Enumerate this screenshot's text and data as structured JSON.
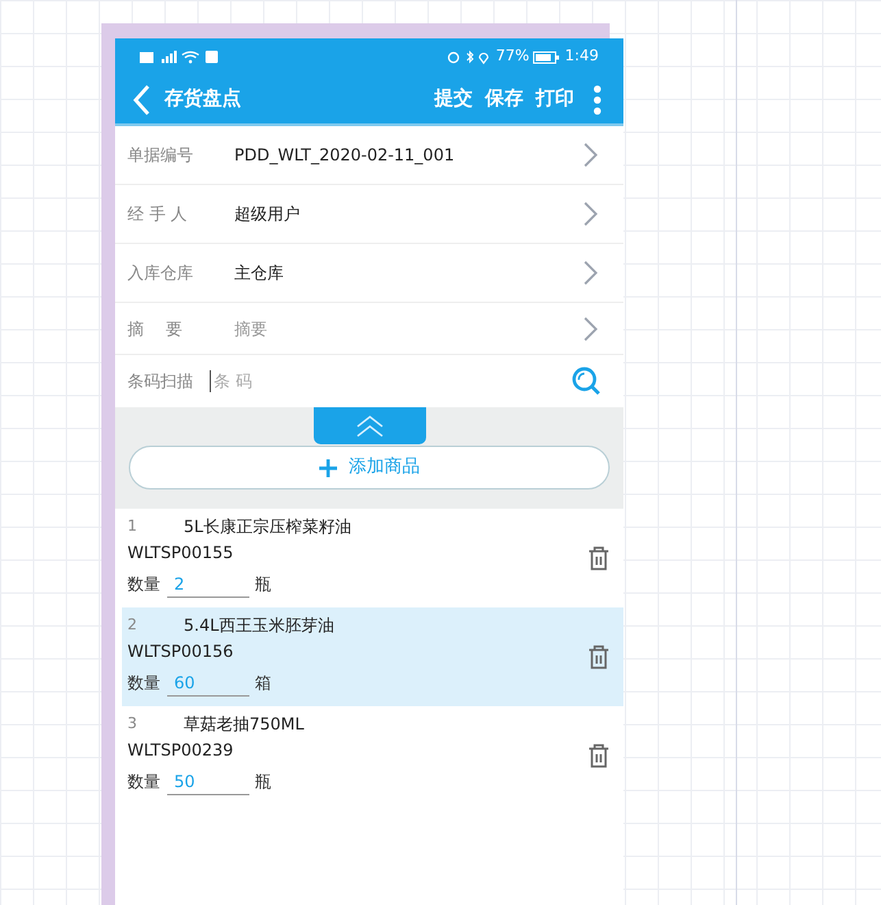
{
  "status_bar": {
    "battery_text": "77%",
    "time": "1:49"
  },
  "header": {
    "title": "存货盘点",
    "actions": [
      "提交",
      "保存",
      "打印"
    ]
  },
  "form": {
    "rows": [
      {
        "label": "单据编号",
        "value": "PDD_WLT_2020-02-11_001"
      },
      {
        "label": "经 手 人",
        "value": "超级用户"
      },
      {
        "label": "入库仓库",
        "value": "主仓库"
      },
      {
        "label": "摘　 要",
        "placeholder": "摘要"
      }
    ],
    "scan": {
      "label": "条码扫描",
      "placeholder": "条 码"
    }
  },
  "add_button": "添加商品",
  "items": [
    {
      "index": "1",
      "name": "5L长康正宗压榨菜籽油",
      "code": "WLTSP00155",
      "qty_label": "数量",
      "qty": "2",
      "unit": "瓶",
      "selected": false
    },
    {
      "index": "2",
      "name": "5.4L西王玉米胚芽油",
      "code": "WLTSP00156",
      "qty_label": "数量",
      "qty": "60",
      "unit": "箱",
      "selected": true
    },
    {
      "index": "3",
      "name": "草菇老抽750ML",
      "code": "WLTSP00239",
      "qty_label": "数量",
      "qty": "50",
      "unit": "瓶",
      "selected": false
    }
  ]
}
